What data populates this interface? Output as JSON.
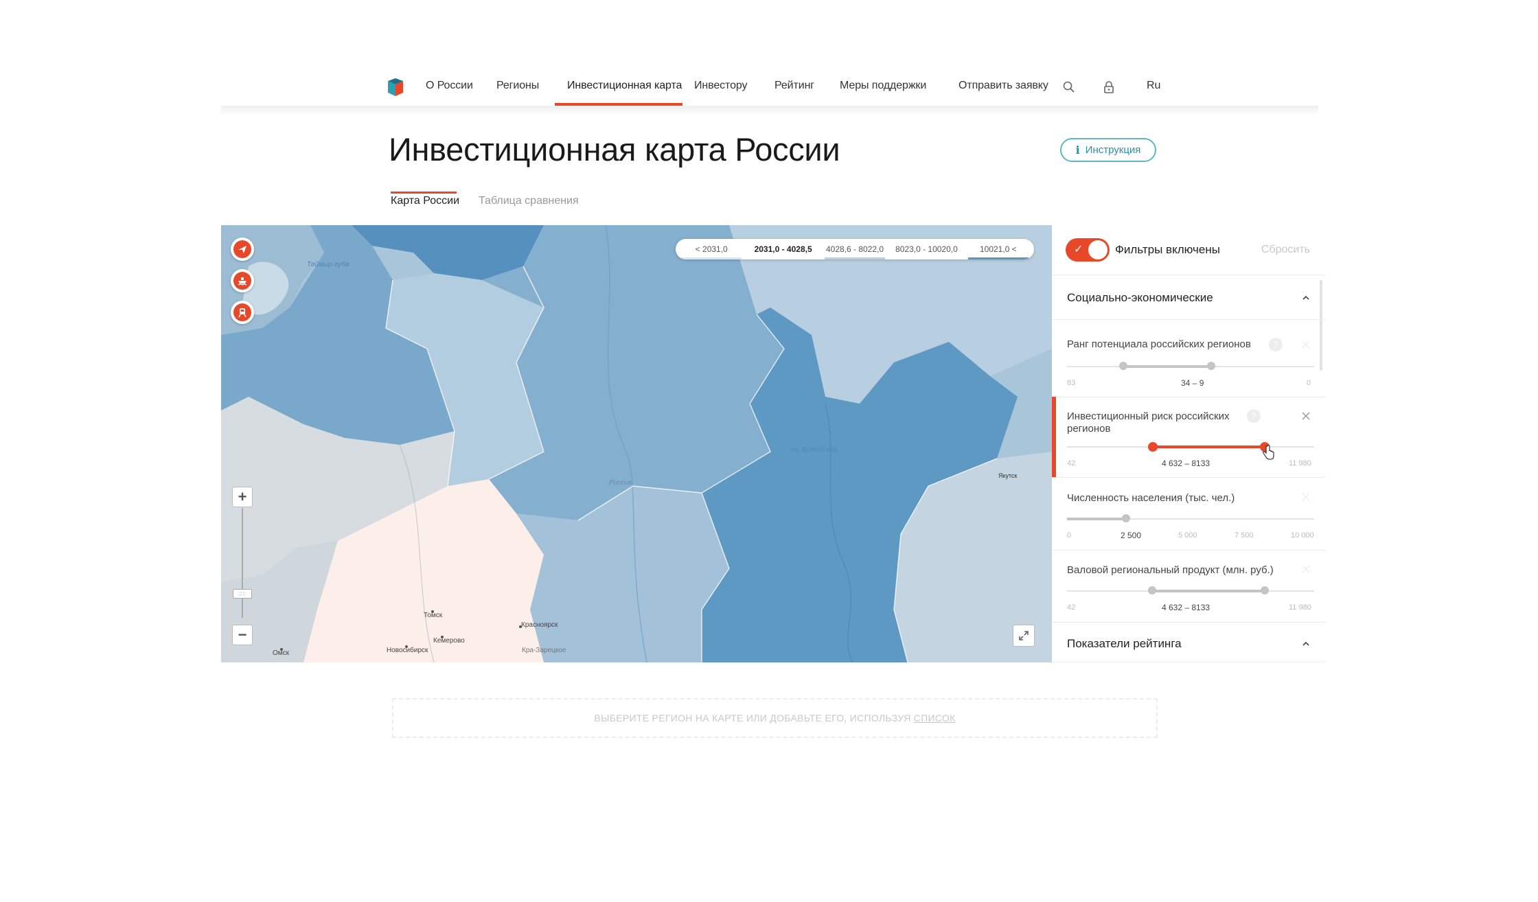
{
  "nav": {
    "items": [
      {
        "label": "О России"
      },
      {
        "label": "Регионы"
      },
      {
        "label": "Инвестиционная карта"
      },
      {
        "label": "Инвестору"
      },
      {
        "label": "Рейтинг"
      },
      {
        "label": "Меры поддержки"
      },
      {
        "label": "Отправить заявку"
      }
    ],
    "active_index": 2,
    "lang": "Ru",
    "accent_color": "#e8482a"
  },
  "page": {
    "title": "Инвестиционная карта России",
    "instruction_button": "Инструкция",
    "tabs": [
      {
        "label": "Карта России",
        "active": true
      },
      {
        "label": "Таблица сравнения",
        "active": false
      }
    ]
  },
  "map": {
    "legend": [
      {
        "label": "< 2031,0",
        "color": "#d9e6ef"
      },
      {
        "label": "2031,0 - 4028,5",
        "color": "#ffffff",
        "selected": true
      },
      {
        "label": "4028,6 - 8022,0",
        "color": "#b9d0e1"
      },
      {
        "label": "8023,0 - 10020,0",
        "color": "#ffffff"
      },
      {
        "label": "10021,0 <",
        "color": "#5c97c2"
      }
    ],
    "transport_icons": [
      "airplane-icon",
      "ship-icon",
      "train-icon"
    ],
    "cities": [
      "Томск",
      "Кемерово",
      "Новосибирск",
      "Омск",
      "Красноярск",
      "Кра-Зарецкое"
    ],
    "labels": [
      "Таймыр-губа",
      "Россия",
      "Якутск",
      "оз. Вилюйское"
    ]
  },
  "filters": {
    "enabled_label": "Фильтры включены",
    "enabled": true,
    "reset_label": "Сбросить",
    "sections": [
      {
        "title": "Социально-экономические",
        "expanded": true,
        "items": [
          {
            "label": "Ранг потенциала российских регионов",
            "min": "83",
            "range": "34 – 9",
            "max": "0",
            "active": false
          },
          {
            "label": "Инвестиционный риск российских регионов",
            "min": "42",
            "range": "4 632 – 8133",
            "max": "11 980",
            "active": true
          },
          {
            "label": "Численность населения (тыс. чел.)",
            "ticks": [
              "0",
              "2 500",
              "5 000",
              "7 500",
              "10 000"
            ],
            "value": "2 500",
            "active": false
          },
          {
            "label": "Валовой региональный продукт (млн. руб.)",
            "min": "42",
            "range": "4 632 – 8133",
            "max": "11 980",
            "active": false
          }
        ]
      },
      {
        "title": "Показатели рейтинга",
        "expanded": true
      }
    ]
  },
  "placeholder": {
    "text": "ВЫБЕРИТЕ РЕГИОН НА КАРТЕ ИЛИ ДОБАВЬТЕ ЕГО, ИСПОЛЬЗУЯ",
    "link": "СПИСОК"
  }
}
